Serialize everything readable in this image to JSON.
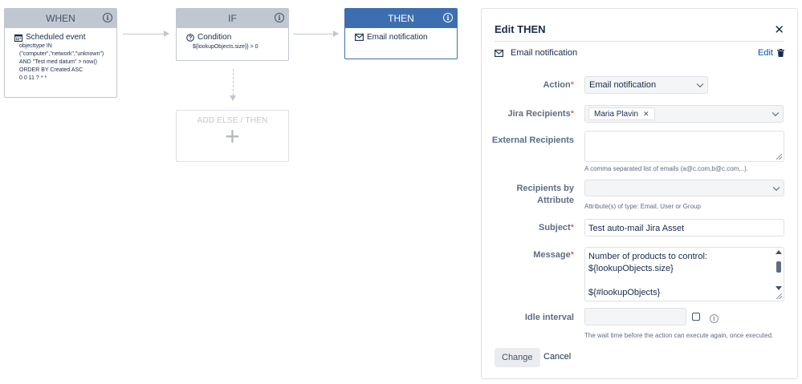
{
  "flow": {
    "when": {
      "header": "WHEN",
      "title": "Scheduled event",
      "detail": "objecttype IN\n(\"computer\",\"network\",\"unknown\")\nAND \"Test med datum\" > now()\nORDER BY Created ASC\n0 0 11 ? * *"
    },
    "if": {
      "header": "IF",
      "title": "Condition",
      "detail": "${lookupObjects.size}} > 0"
    },
    "then": {
      "header": "THEN",
      "title": "Email notification"
    },
    "add_else_label": "ADD ELSE / THEN",
    "add_plus": "+"
  },
  "panel": {
    "title": "Edit THEN",
    "action_name": "Email notification",
    "edit_label": "Edit",
    "fields": {
      "action": {
        "label": "Action",
        "value": "Email notification"
      },
      "jira_recipients": {
        "label": "Jira Recipients",
        "tag": "Maria Plavin"
      },
      "external_recipients": {
        "label": "External Recipients",
        "help": "A comma separated list of emails (a@c.com,b@c.com,..)."
      },
      "recipients_by_attribute": {
        "label_line1": "Recipients by",
        "label_line2": "Attribute",
        "help": "Attribute(s) of type: Email, User or Group"
      },
      "subject": {
        "label": "Subject",
        "value": "Test auto-mail Jira Asset"
      },
      "message": {
        "label": "Message",
        "value": "Number of products to control:\n${lookupObjects.size}\n\n${#lookupObjects}"
      },
      "idle_interval": {
        "label": "Idle interval",
        "help": "The wait time before the action can execute again, once executed."
      }
    },
    "required_mark": "*",
    "change_label": "Change",
    "cancel_label": "Cancel"
  }
}
